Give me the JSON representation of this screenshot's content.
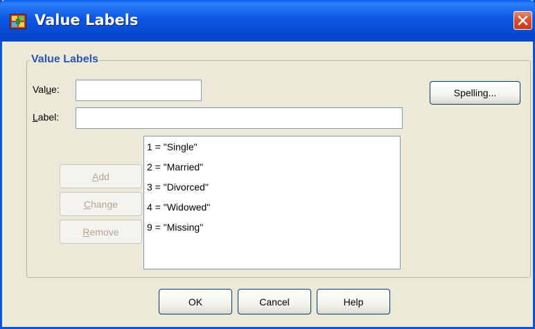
{
  "window": {
    "title": "Value Labels",
    "icon": "spss-grid-icon",
    "close_icon": "close-icon"
  },
  "group": {
    "legend": "Value Labels"
  },
  "fields": {
    "value_label_prefix": "Val",
    "value_label_mnemonic": "u",
    "value_label_suffix": "e:",
    "value_input": "",
    "label_label_mnemonic": "L",
    "label_label_suffix": "abel:",
    "label_input": ""
  },
  "buttons": {
    "spelling": "Spelling...",
    "add_mnemonic": "A",
    "add_rest": "dd",
    "change_mnemonic": "C",
    "change_rest": "hange",
    "remove_mnemonic": "R",
    "remove_rest": "emove",
    "ok": "OK",
    "cancel": "Cancel",
    "help": "Help"
  },
  "value_labels": [
    "1 = \"Single\"",
    "2 = \"Married\"",
    "3 = \"Divorced\"",
    "4 = \"Widowed\"",
    "9 = \"Missing\""
  ],
  "colors": {
    "titlebar": "#0a5ef2",
    "dialog_bg": "#ece9d8",
    "legend": "#2a56b5",
    "close_button": "#d9502f"
  }
}
